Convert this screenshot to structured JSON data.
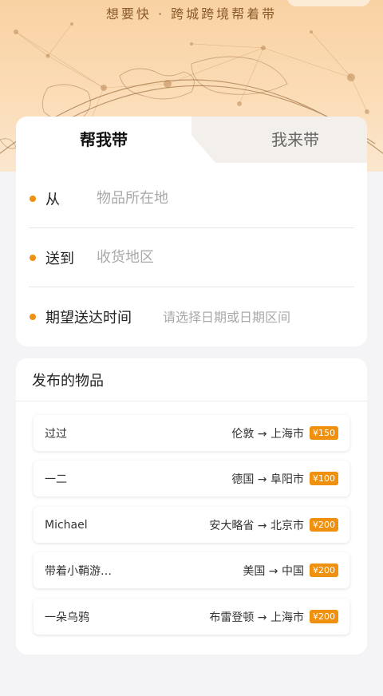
{
  "hero": {
    "tagline": "想要快 · 跨城跨境帮着带"
  },
  "tabs": [
    {
      "label": "帮我带",
      "active": true
    },
    {
      "label": "我来带",
      "active": false
    }
  ],
  "form": {
    "from_label": "从",
    "from_placeholder": "物品所在地",
    "to_label": "送到",
    "to_placeholder": "收货地区",
    "time_label": "期望送达时间",
    "time_placeholder": "请选择日期或日期区间"
  },
  "published": {
    "title": "发布的物品",
    "items": [
      {
        "name": "过过",
        "route": "伦敦 → 上海市",
        "price": "¥150"
      },
      {
        "name": "一二",
        "route": "德国 → 阜阳市",
        "price": "¥100"
      },
      {
        "name": "Michael",
        "route": "安大略省 → 北京市",
        "price": "¥200"
      },
      {
        "name": "带着小鞘游…",
        "route": "美国 → 中国",
        "price": "¥200"
      },
      {
        "name": "一朵乌鸦",
        "route": "布雷登顿 → 上海市",
        "price": "¥200"
      }
    ]
  },
  "colors": {
    "accent": "#f0900f",
    "hero": "#f9d2a3",
    "background": "#f4f4f6"
  }
}
